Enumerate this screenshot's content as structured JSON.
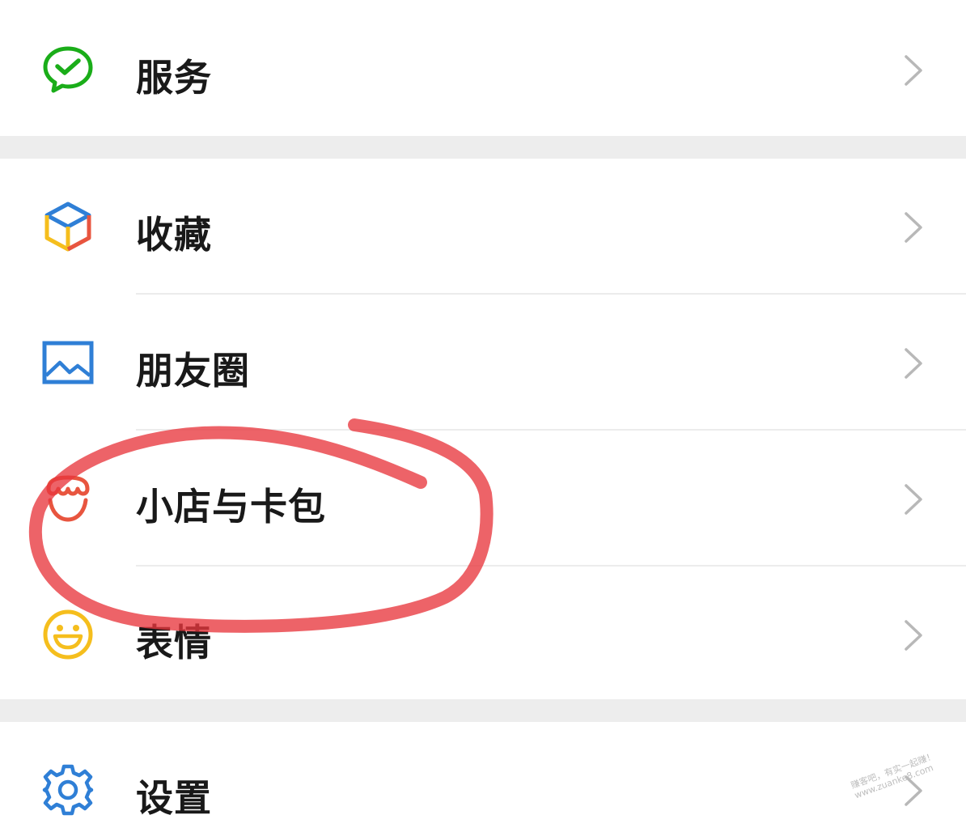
{
  "menu": {
    "services": {
      "label": "服务",
      "icon": "wechat-pay-check-icon",
      "color": "#1aad19"
    },
    "favorites": {
      "label": "收藏",
      "icon": "cube-icon"
    },
    "moments": {
      "label": "朋友圈",
      "icon": "picture-icon",
      "color": "#2f7fd6"
    },
    "cards": {
      "label": "小店与卡包",
      "icon": "shop-awning-icon",
      "color": "#e8553f"
    },
    "stickers": {
      "label": "表情",
      "icon": "smiley-icon",
      "color": "#f5be1d"
    },
    "settings": {
      "label": "设置",
      "icon": "gear-icon",
      "color": "#2f7fd6"
    }
  },
  "annotation": {
    "color": "#e8373e"
  },
  "watermark": {
    "line1": "赚客吧，有实一起赚！",
    "line2": "www.zuanke8.com"
  }
}
